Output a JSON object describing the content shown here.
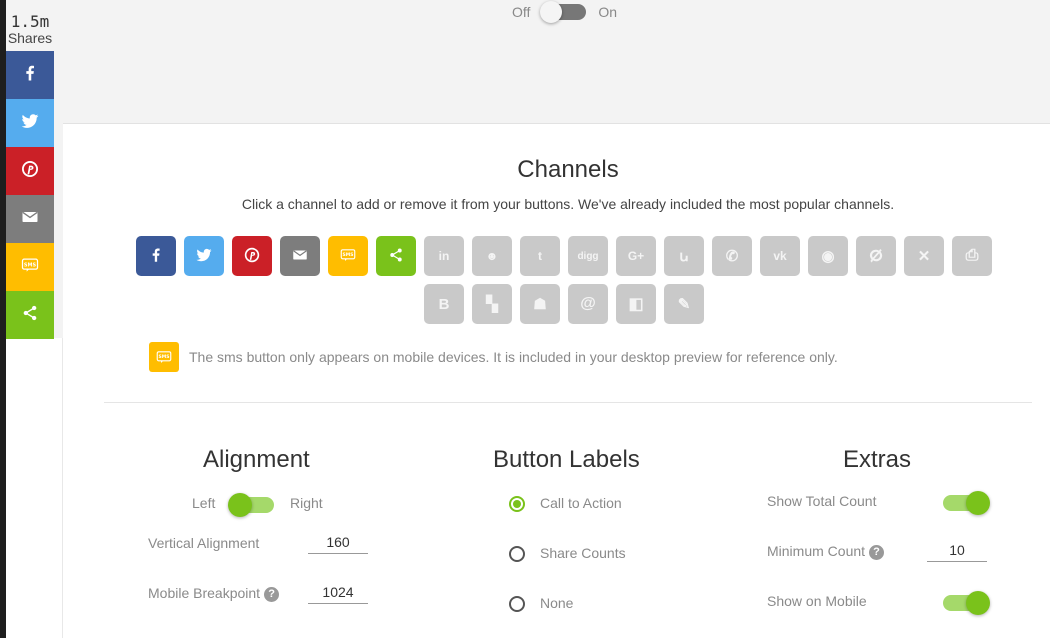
{
  "share_bar": {
    "count": "1.5m",
    "count_label": "Shares",
    "buttons": [
      {
        "network": "facebook",
        "icon": "facebook-icon",
        "color": "#3b5998"
      },
      {
        "network": "twitter",
        "icon": "twitter-icon",
        "color": "#55acee"
      },
      {
        "network": "pinterest",
        "icon": "pinterest-icon",
        "color": "#cb2027"
      },
      {
        "network": "email",
        "icon": "email-icon",
        "color": "#7d7d7d"
      },
      {
        "network": "sms",
        "icon": "sms-icon",
        "color": "#ffbd00"
      },
      {
        "network": "share",
        "icon": "share-icon",
        "color": "#7ac21b"
      }
    ]
  },
  "top_toggle": {
    "off_label": "Off",
    "on_label": "On",
    "state": "off"
  },
  "channels": {
    "title": "Channels",
    "subtitle": "Click a channel to add or remove it from your buttons. We've already included the most popular channels.",
    "active": [
      {
        "name": "facebook",
        "icon": "facebook-icon",
        "color": "#3b5998"
      },
      {
        "name": "twitter",
        "icon": "twitter-icon",
        "color": "#55acee"
      },
      {
        "name": "pinterest",
        "icon": "pinterest-icon",
        "color": "#cb2027"
      },
      {
        "name": "email",
        "icon": "email-icon",
        "color": "#7d7d7d"
      },
      {
        "name": "sms",
        "icon": "sms-icon",
        "color": "#ffbd00"
      },
      {
        "name": "sharethis",
        "icon": "share-icon",
        "color": "#7ac21b"
      }
    ],
    "inactive": [
      {
        "name": "linkedin",
        "icon": "linkedin-icon",
        "glyph": "in"
      },
      {
        "name": "reddit",
        "icon": "reddit-icon",
        "glyph": "☻"
      },
      {
        "name": "tumblr",
        "icon": "tumblr-icon",
        "glyph": "t"
      },
      {
        "name": "digg",
        "icon": "digg-icon",
        "glyph": "digg"
      },
      {
        "name": "googleplus",
        "icon": "googleplus-icon",
        "glyph": "G+"
      },
      {
        "name": "stumbleupon",
        "icon": "stumbleupon-icon",
        "glyph": "ꭎ"
      },
      {
        "name": "whatsapp",
        "icon": "whatsapp-icon",
        "glyph": "✆"
      },
      {
        "name": "vk",
        "icon": "vk-icon",
        "glyph": "vk"
      },
      {
        "name": "weibo",
        "icon": "weibo-icon",
        "glyph": "◉"
      },
      {
        "name": "odnoklassniki",
        "icon": "odnoklassniki-icon",
        "glyph": "ⵁ"
      },
      {
        "name": "xing",
        "icon": "xing-icon",
        "glyph": "✕"
      },
      {
        "name": "print",
        "icon": "print-icon",
        "glyph": "⎙"
      },
      {
        "name": "blogger",
        "icon": "blogger-icon",
        "glyph": "B"
      },
      {
        "name": "flipboard",
        "icon": "flipboard-icon",
        "glyph": "▚"
      },
      {
        "name": "meneame",
        "icon": "meneame-icon",
        "glyph": "☗"
      },
      {
        "name": "email-at",
        "icon": "at-icon",
        "glyph": "@"
      },
      {
        "name": "delicious",
        "icon": "delicious-icon",
        "glyph": "◧"
      },
      {
        "name": "livejournal",
        "icon": "livejournal-icon",
        "glyph": "✎"
      }
    ],
    "sms_note": "The sms button only appears on mobile devices. It is included in your desktop preview for reference only."
  },
  "alignment": {
    "title": "Alignment",
    "left_label": "Left",
    "right_label": "Right",
    "state": "left",
    "vertical_label": "Vertical Alignment",
    "vertical_value": "160",
    "breakpoint_label": "Mobile Breakpoint",
    "breakpoint_value": "1024"
  },
  "button_labels": {
    "title": "Button Labels",
    "options": [
      "Call to Action",
      "Share Counts",
      "None"
    ],
    "selected": "Call to Action"
  },
  "extras": {
    "title": "Extras",
    "show_total_label": "Show Total Count",
    "show_total": true,
    "min_count_label": "Minimum Count",
    "min_count_value": "10",
    "show_mobile_label": "Show on Mobile",
    "show_mobile": true
  },
  "colors": {
    "accent_green": "#7ac21b",
    "toggle_track_green": "#a5d96a",
    "inactive_channel": "#c9c9c9"
  }
}
